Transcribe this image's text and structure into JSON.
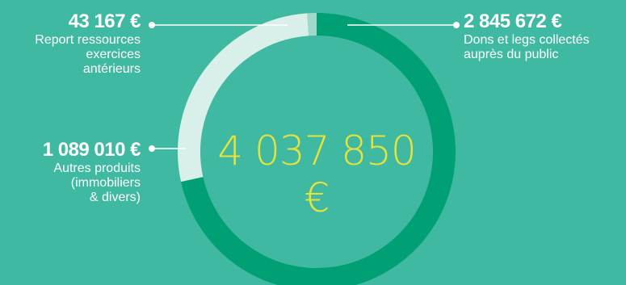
{
  "chart_data": {
    "type": "pie",
    "style": "donut",
    "total": "4 037 850 €",
    "slices": [
      {
        "amount": "2 845 672 €",
        "value": 2845672,
        "label": "Dons et legs collectés auprès du public",
        "color": "#00a074"
      },
      {
        "amount": "1 089 010 €",
        "value": 1089010,
        "label": "Autres produits (immobiliers & divers)",
        "color": "#d9efe9"
      },
      {
        "amount": "43 167 €",
        "value": 43167,
        "label": "Report ressources exercices antérieurs",
        "color": "#9fd9cc"
      }
    ]
  },
  "labels": {
    "dons": {
      "amount": "2 845 672 €",
      "line1": "Dons et legs collectés",
      "line2": "auprès du public"
    },
    "autres": {
      "amount": "1 089 010 €",
      "line1": "Autres produits",
      "line2": "(immobiliers",
      "line3": "& divers)"
    },
    "report": {
      "amount": "43 167 €",
      "line1": "Report ressources",
      "line2": "exercices",
      "line3": "antérieurs"
    }
  }
}
